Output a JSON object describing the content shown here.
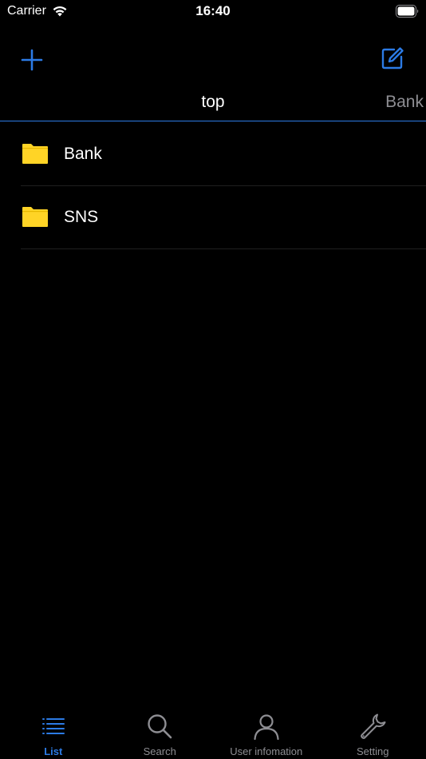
{
  "status_bar": {
    "carrier": "Carrier",
    "time": "16:40"
  },
  "nav": {
    "add_icon": "plus-icon",
    "edit_icon": "compose-icon",
    "accent_color": "#2c7be5"
  },
  "breadcrumb": {
    "current": "top",
    "next": "Bank"
  },
  "folders": [
    {
      "label": "Bank",
      "icon": "folder-icon",
      "color": "#ffd426"
    },
    {
      "label": "SNS",
      "icon": "folder-icon",
      "color": "#ffd426"
    }
  ],
  "tabs": [
    {
      "label": "List",
      "icon": "list-icon",
      "active": true
    },
    {
      "label": "Search",
      "icon": "search-icon",
      "active": false
    },
    {
      "label": "User infomation",
      "icon": "person-icon",
      "active": false
    },
    {
      "label": "Setting",
      "icon": "wrench-icon",
      "active": false
    }
  ]
}
